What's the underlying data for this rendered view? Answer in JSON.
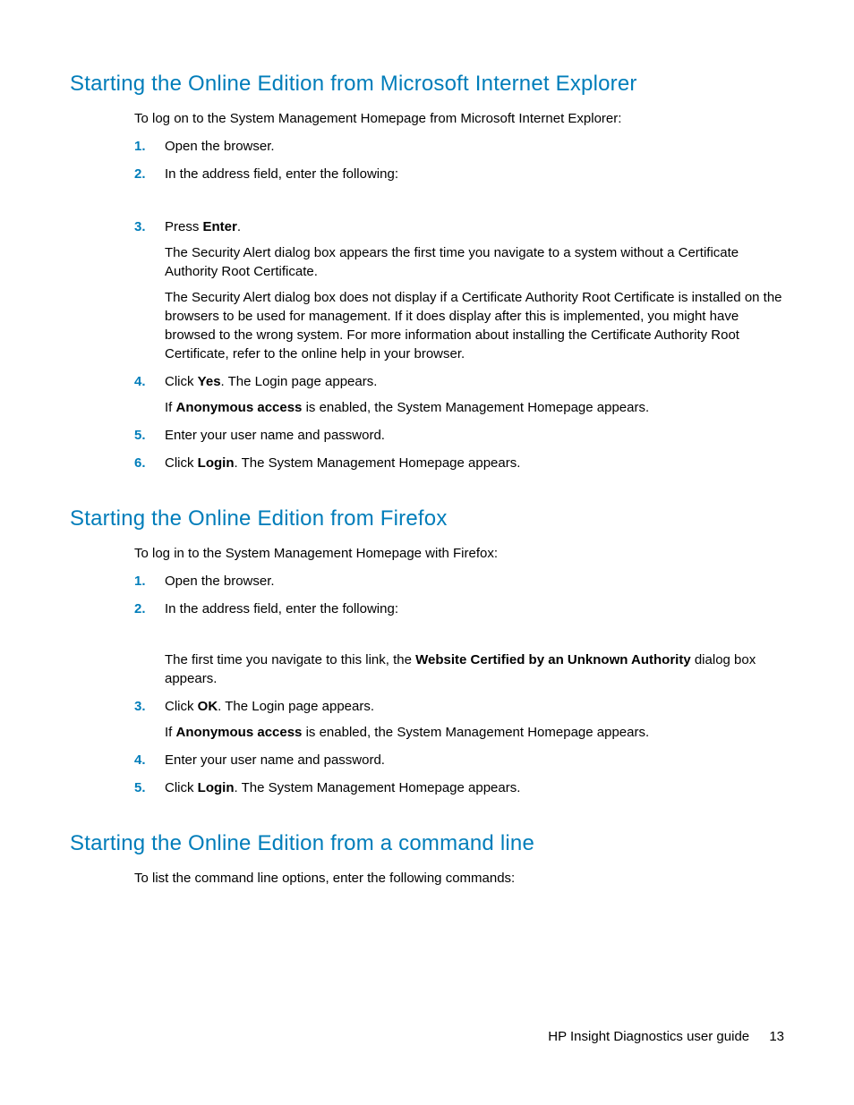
{
  "section1": {
    "heading": "Starting the Online Edition from Microsoft Internet Explorer",
    "intro": "To log on to the System Management Homepage from Microsoft Internet Explorer:",
    "step1": "Open the browser.",
    "step2": "In the address field, enter the following:",
    "step3_a": "Press ",
    "step3_b": "Enter",
    "step3_c": ".",
    "step3_p2": "The Security Alert dialog box appears the first time you navigate to a system without a Certificate Authority Root Certificate.",
    "step3_p3": "The Security Alert dialog box does not display if a Certificate Authority Root Certificate is installed on the browsers to be used for management. If it does display after this is implemented, you might have browsed to the wrong system. For more information about installing the Certificate Authority Root Certificate, refer to the online help in your browser.",
    "step4_a": "Click ",
    "step4_b": "Yes",
    "step4_c": ". The Login page appears.",
    "step4_p2_a": "If ",
    "step4_p2_b": "Anonymous access",
    "step4_p2_c": " is enabled, the System Management Homepage appears.",
    "step5": "Enter your user name and password.",
    "step6_a": "Click ",
    "step6_b": "Login",
    "step6_c": ". The System Management Homepage appears."
  },
  "section2": {
    "heading": "Starting the Online Edition from Firefox",
    "intro": "To log in to the System Management Homepage with Firefox:",
    "step1": "Open the browser.",
    "step2": "In the address field, enter the following:",
    "step2_p2_a": "The first time you navigate to this link, the ",
    "step2_p2_b": "Website Certified by an Unknown Authority",
    "step2_p2_c": " dialog box appears.",
    "step3_a": "Click ",
    "step3_b": "OK",
    "step3_c": ". The Login page appears.",
    "step3_p2_a": "If ",
    "step3_p2_b": "Anonymous access",
    "step3_p2_c": " is enabled, the System Management Homepage appears.",
    "step4": "Enter your user name and password.",
    "step5_a": "Click ",
    "step5_b": "Login",
    "step5_c": ". The System Management Homepage appears."
  },
  "section3": {
    "heading": "Starting the Online Edition from a command line",
    "intro": "To list the command line options, enter the following commands:"
  },
  "nums": {
    "n1": "1.",
    "n2": "2.",
    "n3": "3.",
    "n4": "4.",
    "n5": "5.",
    "n6": "6."
  },
  "footer": {
    "title": "HP Insight Diagnostics user guide",
    "page": "13"
  }
}
